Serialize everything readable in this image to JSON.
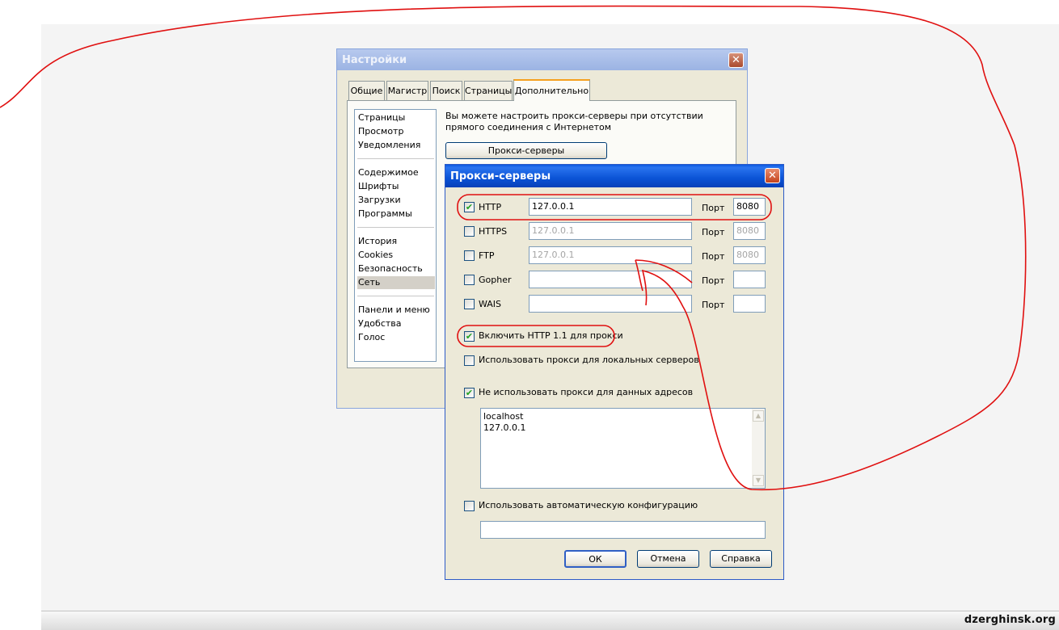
{
  "watermark": "dzerghinsk.org",
  "settings_window": {
    "title": "Настройки",
    "close_label": "✕",
    "tabs": [
      "Общие",
      "Магистр",
      "Поиск",
      "Страницы",
      "Дополнительно"
    ],
    "active_tab": "Дополнительно",
    "nav_groups": [
      [
        "Страницы",
        "Просмотр",
        "Уведомления"
      ],
      [
        "Содержимое",
        "Шрифты",
        "Загрузки",
        "Программы"
      ],
      [
        "История",
        "Cookies",
        "Безопасность",
        "Сеть"
      ],
      [
        "Панели и меню",
        "Удобства",
        "Голос"
      ]
    ],
    "selected_nav": "Сеть",
    "description": "Вы можете настроить прокси-серверы при отсутствии прямого соединения с Интернетом",
    "proxy_button": "Прокси-серверы"
  },
  "proxy_window": {
    "title": "Прокси-серверы",
    "close_label": "✕",
    "port_label": "Порт",
    "rows": [
      {
        "protocol": "HTTP",
        "checked": true,
        "address": "127.0.0.1",
        "port": "8080"
      },
      {
        "protocol": "HTTPS",
        "checked": false,
        "address": "127.0.0.1",
        "port": "8080"
      },
      {
        "protocol": "FTP",
        "checked": false,
        "address": "127.0.0.1",
        "port": "8080"
      },
      {
        "protocol": "Gopher",
        "checked": false,
        "address": "",
        "port": ""
      },
      {
        "protocol": "WAIS",
        "checked": false,
        "address": "",
        "port": ""
      }
    ],
    "enable_http11": {
      "label": "Включить HTTP 1.1 для прокси",
      "checked": true
    },
    "use_for_local": {
      "label": "Использовать прокси для локальных серверов",
      "checked": false
    },
    "no_proxy_for": {
      "label": "Не использовать прокси для данных адресов",
      "checked": true
    },
    "no_proxy_list": [
      "localhost",
      "127.0.0.1"
    ],
    "auto_config": {
      "label": "Использовать автоматическую конфигурацию",
      "checked": false,
      "url": ""
    },
    "buttons": {
      "ok": "ОК",
      "cancel": "Отмена",
      "help": "Справка"
    }
  },
  "colors": {
    "annotation_red": "#e01010",
    "xp_title_blue": "#0b53d6",
    "dialog_face": "#ece9d8"
  }
}
